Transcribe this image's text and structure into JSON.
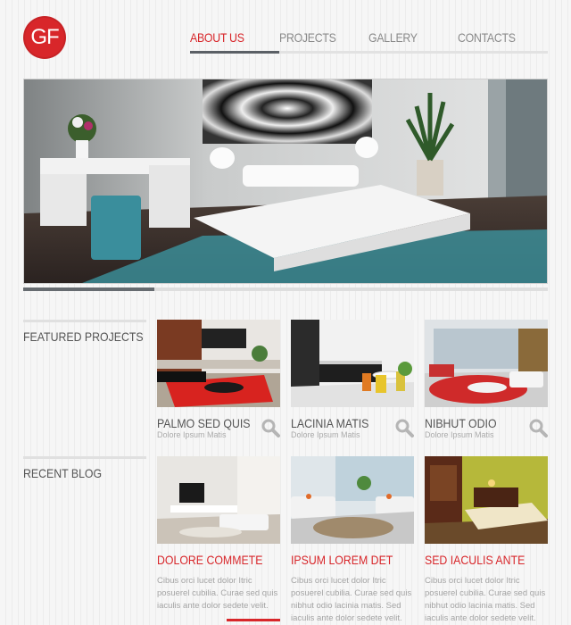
{
  "brand": {
    "logo_text": "GF",
    "color": "#d8262a"
  },
  "nav": {
    "items": [
      {
        "label": "ABOUT US",
        "active": true
      },
      {
        "label": "PROJECTS",
        "active": false
      },
      {
        "label": "GALLERY",
        "active": false
      },
      {
        "label": "CONTACTS",
        "active": false
      }
    ]
  },
  "hero": {
    "image": "modern-bedroom-photo",
    "slider_progress": 0.25
  },
  "featured": {
    "heading": "FEATURED PROJECTS",
    "items": [
      {
        "title": "PALMO SED QUIS",
        "subtitle": "Dolore Ipsum Matis",
        "icon": "magnifier-icon"
      },
      {
        "title": "LACINIA MATIS",
        "subtitle": "Dolore Ipsum Matis",
        "icon": "magnifier-icon"
      },
      {
        "title": "NIBHUT ODIO",
        "subtitle": "Dolore Ipsum Matis",
        "icon": "magnifier-icon"
      }
    ]
  },
  "blog": {
    "heading": "RECENT BLOG",
    "items": [
      {
        "title": "DOLORE COMMETE",
        "text": "Cibus orci lucet dolor Itric posuerel cubilia. Curae sed quis iaculis ante dolor sedete velit."
      },
      {
        "title": "IPSUM LOREM DET",
        "text": "Cibus orci lucet dolor Itric posuerel cubilia. Curae sed quis nibhut odio lacinia matis. Sed iaculis ante dolor sedete velit."
      },
      {
        "title": "SED IACULIS ANTE",
        "text": "Cibus orci lucet dolor Itric posuerel cubilia. Curae sed quis nibhut odio lacinia matis. Sed iaculis ante dolor sedete velit."
      }
    ]
  }
}
